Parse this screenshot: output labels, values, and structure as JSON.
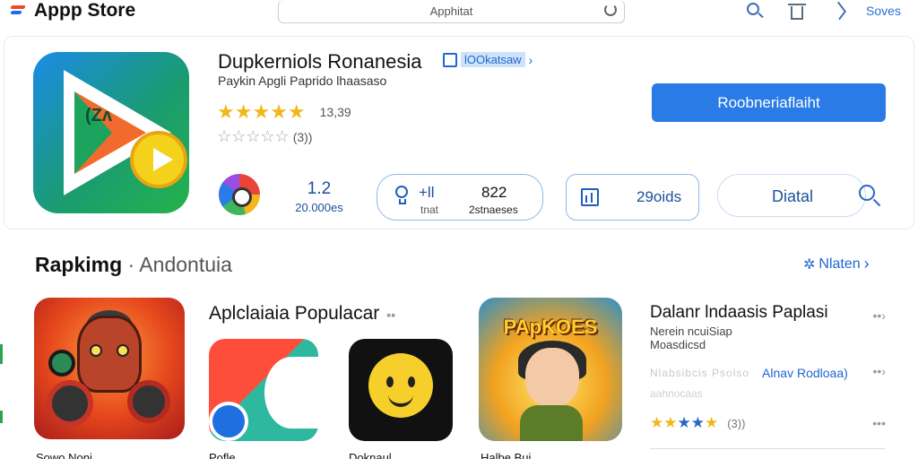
{
  "topbar": {
    "app_title": "Appp Store",
    "search_text": "Apphitat",
    "right_label": "Soves"
  },
  "app": {
    "name": "Dupkerniols Ronanesia",
    "badge": "lOOkatsaw",
    "subtitle": "Paykin Apgli Paprido lhaasaso",
    "rating_value": "13,39",
    "rating_stars": "★★★★★",
    "secondary_stars": "☆☆☆☆☆",
    "secondary_count": "(3))",
    "get_button": "Roobneriaflaiht"
  },
  "stats": {
    "score": "1.2",
    "score_label": "20.000es",
    "pill1_a": "+ll",
    "pill1_a_label": "tnat",
    "pill1_b": "822",
    "pill1_b_label": "2stnaeses",
    "pill2_text": "29oids",
    "pill3_text": "Diatal"
  },
  "section": {
    "title_bold": "Rapkimg",
    "title_rest": "· Andontuia",
    "link": "Nlaten",
    "popular": "Aplclaiaia Populacar",
    "tiles": [
      {
        "name": "Sowo Noni"
      },
      {
        "name": "Pofle"
      },
      {
        "name": "Doknaul"
      },
      {
        "name": "Halbe Bui"
      }
    ],
    "t4_label": "PApKOES"
  },
  "right_list": {
    "title": "Dalanr lndaasis Paplasi",
    "sub1": "Nerein ncuiSiap",
    "sub2": "Moasdicsd",
    "blur_text": "Nlabsibcis Psolso",
    "link": "Alnav Rodloaa)",
    "blur2": "aahnocaas",
    "stars_gold": "★★",
    "stars_blue": "★★",
    "stars_gold2": "★",
    "count": "(3))",
    "more": "•••"
  },
  "colors": {
    "accent": "#2a7be6",
    "link": "#2067d0",
    "star": "#f2b71c"
  }
}
